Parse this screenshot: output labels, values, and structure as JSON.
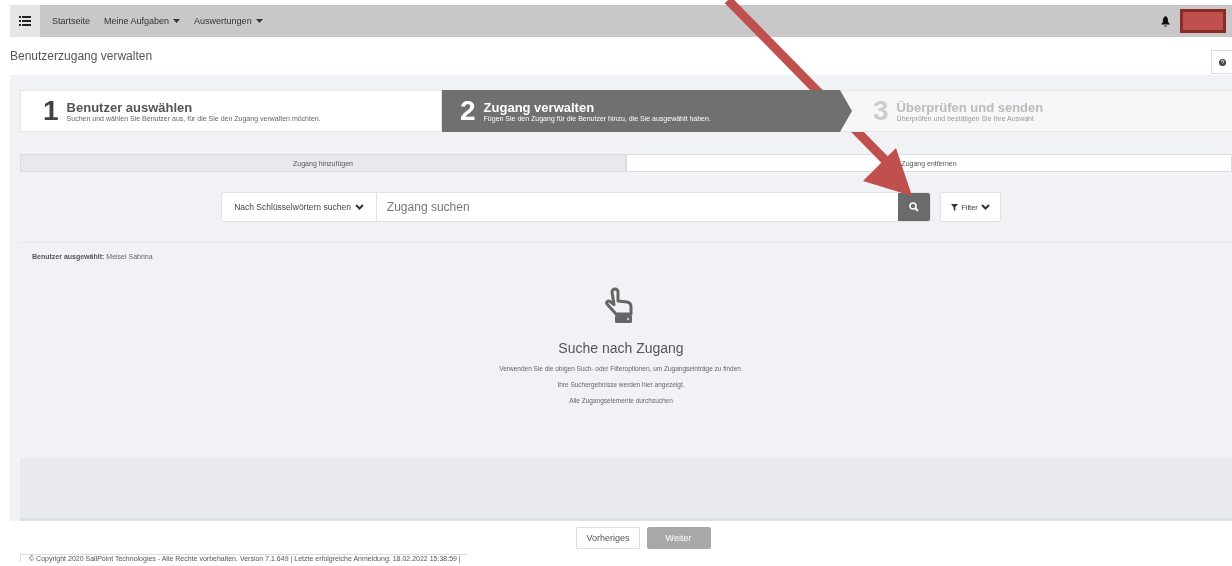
{
  "navbar": {
    "menu": [
      {
        "label": "Startseite",
        "dropdown": false
      },
      {
        "label": "Meine Aufgaben",
        "dropdown": true
      },
      {
        "label": "Auswertungen",
        "dropdown": true
      }
    ]
  },
  "page_title": "Benutzerzugang verwalten",
  "steps": [
    {
      "number": "1",
      "title": "Benutzer auswählen",
      "subtitle": "Suchen und wählen Sie Benutzer aus, für die Sie den Zugang verwalten möchten.",
      "selected": false,
      "disabled": false
    },
    {
      "number": "2",
      "title": "Zugang verwalten",
      "subtitle": "Fügen Sie den Zugang für die Benutzer hinzu, die Sie ausgewählt haben.",
      "selected": true,
      "disabled": false
    },
    {
      "number": "3",
      "title": "Überprüfen und senden",
      "subtitle": "Überprüfen und bestätigen Sie Ihre Auswahl.",
      "selected": false,
      "disabled": true
    }
  ],
  "tabs": [
    {
      "label": "Zugang hinzufügen",
      "selected": false
    },
    {
      "label": "Zugang entfernen",
      "selected": true
    }
  ],
  "search": {
    "mode": "Nach Schlüsselwörtern suchen",
    "placeholder": "Zugang suchen",
    "filter": "Filter"
  },
  "selected_users": {
    "label": "Benutzer ausgewählt:",
    "value": "Meisel Sabrina"
  },
  "empty_state": {
    "title": "Suche nach Zugang",
    "lines": [
      "Verwenden Sie die obigen Such- oder Filteroptionen, um Zugangseinträge zu finden.",
      "Ihre Suchergebnisse werden hier angezeigt.",
      "Alle Zugangselemente durchsuchen"
    ]
  },
  "buttons": [
    {
      "label": "Vorheriges",
      "disabled": false
    },
    {
      "label": "Weiter",
      "disabled": true
    }
  ],
  "copyright": "© Copyright 2020 SailPoint Technologies - Alle Rechte vorbehalten. Version 7.1.649 | Letzte erfolgreiche Anmeldung: 18.02.2022 15:38:59 |"
}
